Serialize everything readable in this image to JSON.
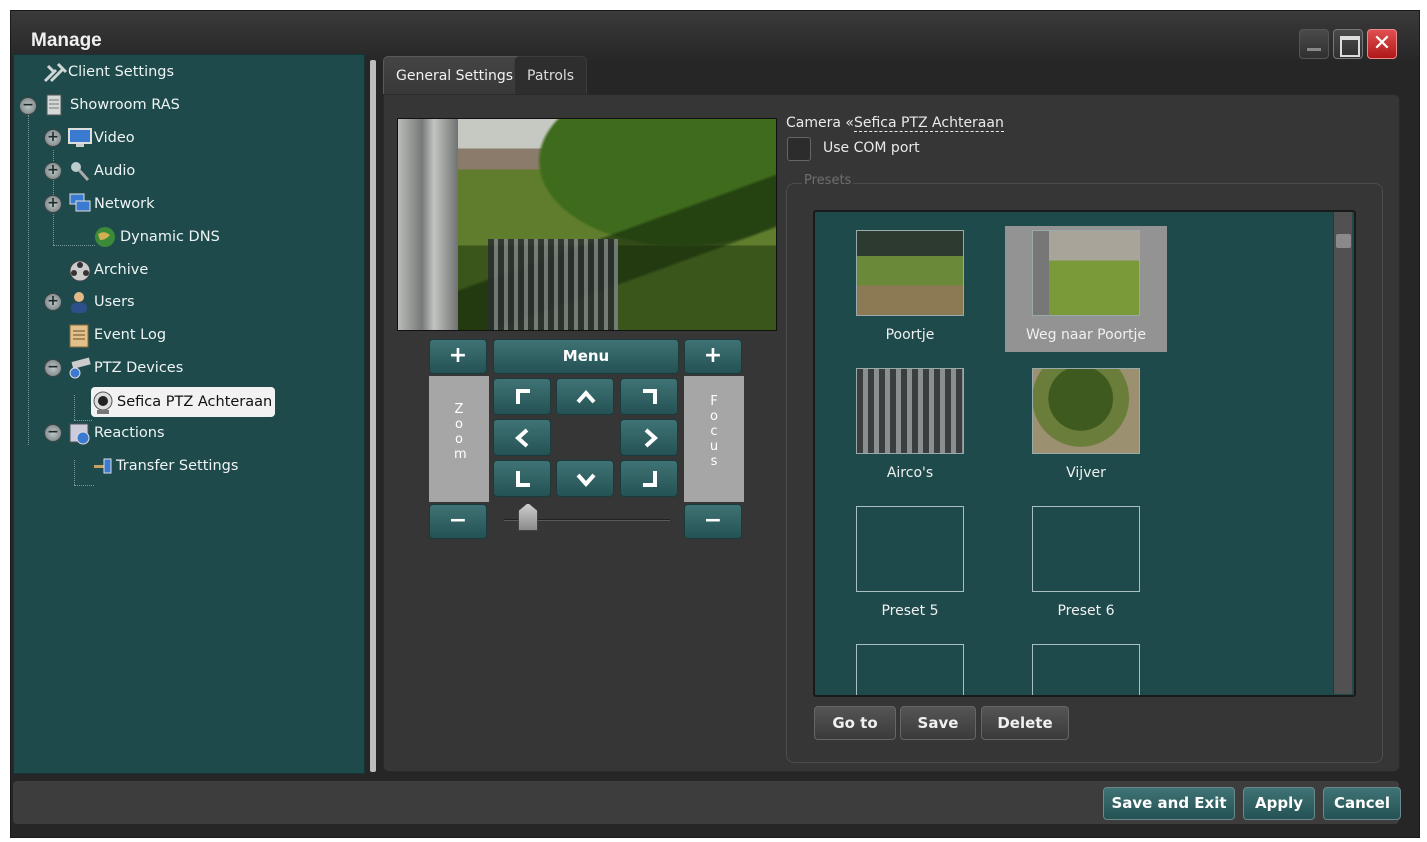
{
  "window": {
    "title": "Manage",
    "controls": [
      "minimize-icon",
      "maximize-icon",
      "close-icon"
    ]
  },
  "tree": {
    "items": [
      {
        "label": "Client Settings",
        "icon": "tools-icon"
      },
      {
        "label": "Showroom RAS",
        "icon": "server-icon",
        "expander": "−"
      },
      {
        "label": "Video",
        "icon": "monitor-icon",
        "expander": "+"
      },
      {
        "label": "Audio",
        "icon": "microphone-icon",
        "expander": "+"
      },
      {
        "label": "Network",
        "icon": "network-icon",
        "expander": "+"
      },
      {
        "label": "Dynamic DNS",
        "icon": "globe-icon"
      },
      {
        "label": "Archive",
        "icon": "film-reel-icon"
      },
      {
        "label": "Users",
        "icon": "users-icon",
        "expander": "+"
      },
      {
        "label": "Event Log",
        "icon": "log-icon"
      },
      {
        "label": "PTZ Devices",
        "icon": "ptz-camera-icon",
        "expander": "−"
      },
      {
        "label": "Sefica PTZ Achteraan",
        "icon": "webcam-icon",
        "selected": true
      },
      {
        "label": "Reactions",
        "icon": "reactions-icon",
        "expander": "−"
      },
      {
        "label": "Transfer Settings",
        "icon": "transfer-icon"
      }
    ]
  },
  "tabs": {
    "general": "General Settings",
    "patrols": "Patrols"
  },
  "ptz": {
    "plus": "+",
    "minus": "−",
    "menu": "Menu",
    "zoom_label": "Z o o m",
    "focus_label": "F o c u s"
  },
  "camera": {
    "prefix": "Camera «",
    "name": "Sefica PTZ Achteraan",
    "use_com_port": "Use COM port"
  },
  "presets": {
    "legend": "Presets",
    "items": [
      {
        "label": "Poortje"
      },
      {
        "label": "Weg naar Poortje",
        "selected": true
      },
      {
        "label": "Airco's"
      },
      {
        "label": "Vijver"
      },
      {
        "label": "Preset 5"
      },
      {
        "label": "Preset 6"
      }
    ],
    "buttons": {
      "goto": "Go to",
      "save": "Save",
      "delete": "Delete"
    }
  },
  "footer": {
    "save_exit": "Save and Exit",
    "apply": "Apply",
    "cancel": "Cancel"
  }
}
